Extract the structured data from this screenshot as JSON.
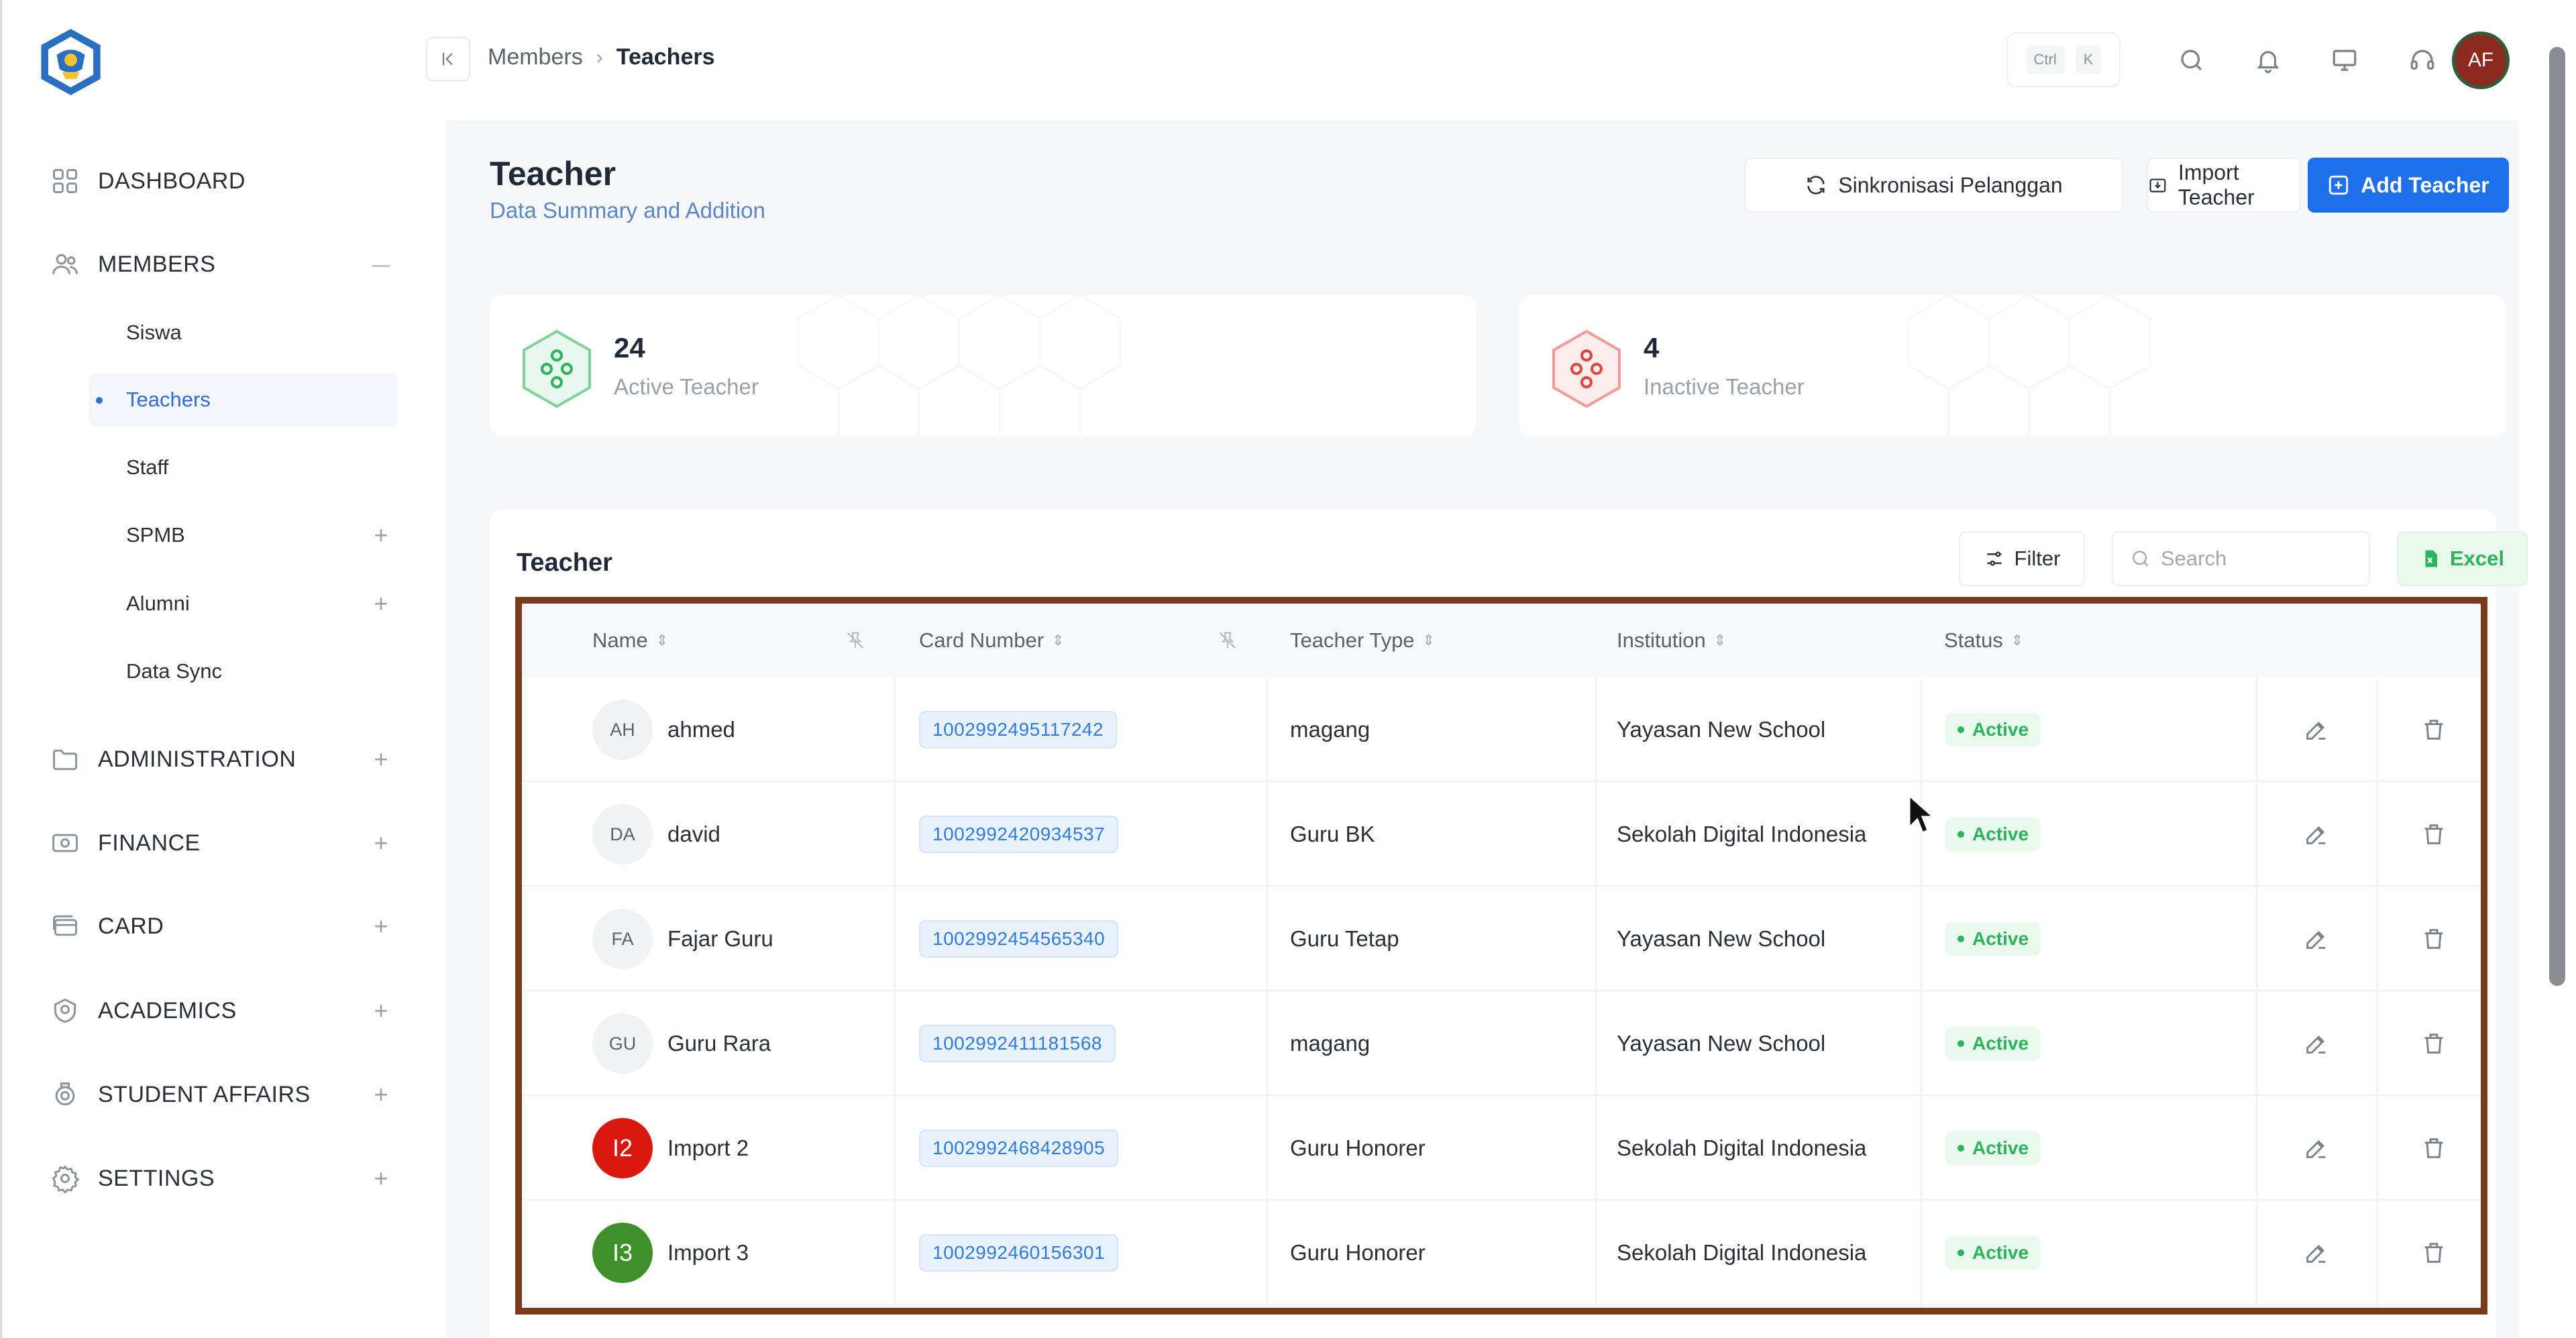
{
  "breadcrumb": {
    "parent": "Members",
    "separator": "›",
    "current": "Teachers"
  },
  "topbar": {
    "shortcut_ctrl": "Ctrl",
    "shortcut_key": "K",
    "avatar_initials": "AF"
  },
  "sidebar": {
    "dashboard": "DASHBOARD",
    "members": "MEMBERS",
    "members_toggle": "—",
    "sub_items": [
      "Siswa",
      "Teachers",
      "Staff",
      "SPMB",
      "Alumni",
      "Data Sync"
    ],
    "administration": "ADMINISTRATION",
    "finance": "FINANCE",
    "card": "CARD",
    "academics": "ACADEMICS",
    "student_affairs": "STUDENT AFFAIRS",
    "settings": "SETTINGS",
    "expand": "+"
  },
  "page": {
    "title": "Teacher",
    "subtitle": "Data Summary and Addition",
    "btn_sync": "Sinkronisasi Pelanggan",
    "btn_import": "Import Teacher",
    "btn_add": "Add Teacher"
  },
  "stats": {
    "active_value": "24",
    "active_label": "Active Teacher",
    "inactive_value": "4",
    "inactive_label": "Inactive Teacher"
  },
  "table": {
    "title": "Teacher",
    "filter": "Filter",
    "search_placeholder": "Search",
    "excel": "Excel",
    "columns": [
      "Name",
      "Card Number",
      "Teacher Type",
      "Institution",
      "Status"
    ],
    "rows": [
      {
        "initials": "AH",
        "name": "ahmed",
        "card": "1002992495117242",
        "type": "magang",
        "institution": "Yayasan New School",
        "status": "Active",
        "avatar_color": "#f1f2f4"
      },
      {
        "initials": "DA",
        "name": "david",
        "card": "1002992420934537",
        "type": "Guru BK",
        "institution": "Sekolah Digital Indonesia",
        "status": "Active",
        "avatar_color": "#f1f2f4"
      },
      {
        "initials": "FA",
        "name": "Fajar Guru",
        "card": "1002992454565340",
        "type": "Guru Tetap",
        "institution": "Yayasan New School",
        "status": "Active",
        "avatar_color": "#f1f2f4"
      },
      {
        "initials": "GU",
        "name": "Guru Rara",
        "card": "1002992411181568",
        "type": "magang",
        "institution": "Yayasan New School",
        "status": "Active",
        "avatar_color": "#f1f2f4"
      },
      {
        "initials": "I2",
        "name": "Import 2",
        "card": "1002992468428905",
        "type": "Guru Honorer",
        "institution": "Sekolah Digital Indonesia",
        "status": "Active",
        "avatar_color": "#d9170f"
      },
      {
        "initials": "I3",
        "name": "Import 3",
        "card": "1002992460156301",
        "type": "Guru Honorer",
        "institution": "Sekolah Digital Indonesia",
        "status": "Active",
        "avatar_color": "#3f8f2a"
      }
    ]
  },
  "colors": {
    "accent": "#1f6feb",
    "active_green": "#2bb55a",
    "highlight_frame": "#7a3a1c"
  }
}
